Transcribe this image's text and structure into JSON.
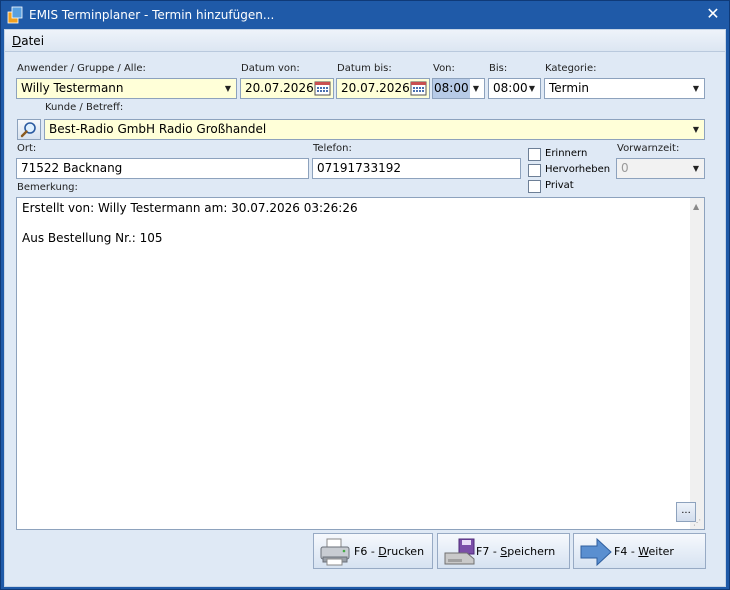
{
  "window": {
    "title": "EMIS Terminplaner - Termin hinzufügen...",
    "close_glyph": "✕"
  },
  "menu": {
    "datei_prefix": "D",
    "datei_rest": "atei"
  },
  "labels": {
    "anwender": "Anwender / Gruppe / Alle:",
    "datum_von": "Datum von:",
    "datum_bis": "Datum bis:",
    "von": "Von:",
    "bis": "Bis:",
    "kategorie": "Kategorie:",
    "kunde": "Kunde / Betreff:",
    "ort": "Ort:",
    "telefon": "Telefon:",
    "vorwarnzeit": "Vorwarnzeit:",
    "bemerkung": "Bemerkung:"
  },
  "fields": {
    "anwender": "Willy Testermann",
    "datum_von": "20.07.2026",
    "datum_bis": "20.07.2026",
    "von": "08:00",
    "bis": "08:00",
    "kategorie": "Termin",
    "kunde": "Best-Radio GmbH Radio Großhandel",
    "ort": "71522 Backnang",
    "telefon": "07191733192",
    "vorwarnzeit": "0"
  },
  "checkboxes": {
    "erinnern": {
      "label": "Erinnern",
      "checked": false
    },
    "hervorheben": {
      "label": "Hervorheben",
      "checked": false
    },
    "privat": {
      "label": "Privat",
      "checked": false
    }
  },
  "memo": {
    "line1": "Erstellt von: Willy Testermann am: 30.07.2026 03:26:26",
    "line2": "Aus Bestellung Nr.: 105",
    "ellipsis": "..."
  },
  "buttons": {
    "drucken": {
      "prefix": "F6 - ",
      "accel": "D",
      "rest": "rucken"
    },
    "speichern": {
      "prefix": "F7 - ",
      "accel": "S",
      "rest": "peichern"
    },
    "weiter": {
      "prefix": "F4 - ",
      "accel": "W",
      "rest": "eiter"
    }
  }
}
